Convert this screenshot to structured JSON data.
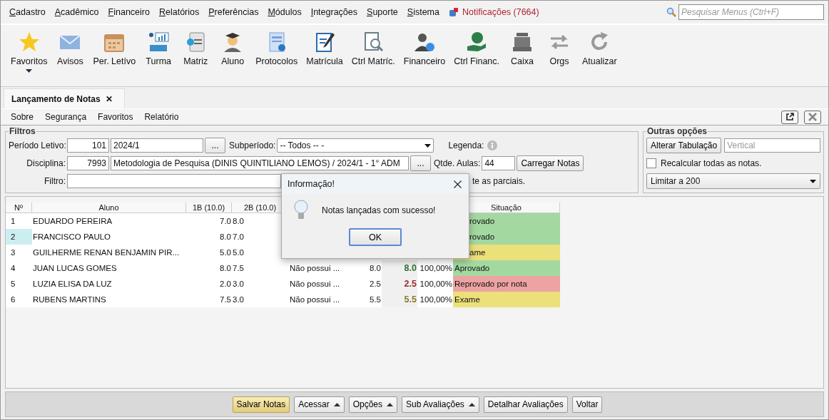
{
  "menu": [
    "Cadastro",
    "Acadêmico",
    "Financeiro",
    "Relatórios",
    "Preferências",
    "Módulos",
    "Integrações",
    "Suporte",
    "Sistema"
  ],
  "notifications": "Notificações (7664)",
  "search": {
    "placeholder": "Pesquisar Menus (Ctrl+F)"
  },
  "toolbar": [
    {
      "label": "Favoritos",
      "dropdown": true
    },
    {
      "label": "Avisos"
    },
    {
      "label": "Per. Letívo"
    },
    {
      "label": "Turma"
    },
    {
      "label": "Matriz"
    },
    {
      "label": "Aluno"
    },
    {
      "label": "Protocolos"
    },
    {
      "label": "Matrícula"
    },
    {
      "label": "Ctrl Matríc."
    },
    {
      "label": "Financeiro"
    },
    {
      "label": "Ctrl Financ."
    },
    {
      "label": "Caixa"
    },
    {
      "label": "Orgs"
    },
    {
      "label": "Atualizar"
    }
  ],
  "tab": {
    "label": "Lançamento de Notas",
    "close": "✕"
  },
  "submenu": [
    "Sobre",
    "Segurança",
    "Favoritos",
    "Relatório"
  ],
  "filters": {
    "title": "Filtros",
    "periodo": {
      "label": "Período Letivo:",
      "code": "101",
      "value": "2024/1",
      "browse": "..."
    },
    "subperiodo": {
      "label": "Subperíodo:",
      "value": "-- Todos -- -"
    },
    "legenda": "Legenda:",
    "disciplina": {
      "label": "Disciplina:",
      "code": "7993",
      "value": "Metodologia de Pesquisa (DINIS QUINTILIANO LEMOS) / 2024/1 - 1° ADM",
      "browse": "..."
    },
    "aulas": {
      "label": "Qtde. Aulas:",
      "value": "44"
    },
    "load_button": "Carregar Notas",
    "filtro": {
      "label": "Filtro:"
    },
    "partial_option": "te as parciais."
  },
  "other_options": {
    "title": "Outras opções",
    "tab_button": "Alterar Tabulação",
    "tab_value": "Vertical",
    "recalc": {
      "label": "Recalcular todas as notas.",
      "checked": false
    },
    "limit": "Limitar a 200"
  },
  "table": {
    "columns": [
      {
        "label": "Nº"
      },
      {
        "label": "Aluno"
      },
      {
        "label": "1B (10.0)"
      },
      {
        "label": "2B (10.0)"
      },
      {},
      {},
      {},
      {},
      {
        "label": "Situação"
      }
    ],
    "rows": [
      {
        "num": "1",
        "name": "EDUARDO PEREIRA",
        "b1": "7.0",
        "b2": "8.0",
        "selected": false,
        "status": {
          "text": "rovado",
          "color": "#a3d9a0"
        }
      },
      {
        "num": "2",
        "name": "FRANCISCO PAULO",
        "b1": "8.0",
        "b2": "7.0",
        "selected": true,
        "status": {
          "text": "rovado",
          "color": "#a3d9a0"
        }
      },
      {
        "num": "3",
        "name": "GUILHERME RENAN BENJAMIN PIR...",
        "b1": "5.0",
        "b2": "5.0",
        "selected": false,
        "status": {
          "text": "ame",
          "color": "#ece07a"
        }
      },
      {
        "num": "4",
        "name": "JUAN LUCAS GOMES",
        "b1": "8.0",
        "b2": "7.5",
        "selected": false,
        "obs": "Não possui ...",
        "media": "8.0",
        "final": {
          "text": "8.0",
          "color": "#2f6f2f"
        },
        "freq": "100,00%",
        "status": {
          "text": "Aprovado",
          "color": "#a3d9a0"
        }
      },
      {
        "num": "5",
        "name": "LUZIA ELISA DA LUZ",
        "b1": "2.0",
        "b2": "3.0",
        "selected": false,
        "obs": "Não possui ...",
        "media": "2.5",
        "final": {
          "text": "2.5",
          "color": "#9c2b2b"
        },
        "freq": "100,00%",
        "status": {
          "text": "Reprovado por nota",
          "color": "#eea3a3"
        }
      },
      {
        "num": "6",
        "name": "RUBENS MARTINS",
        "b1": "7.5",
        "b2": "3.0",
        "selected": false,
        "obs": "Não possui ...",
        "media": "5.5",
        "final": {
          "text": "5.5",
          "color": "#8a7a1f"
        },
        "freq": "100,00%",
        "status": {
          "text": "Exame",
          "color": "#ece07a"
        }
      }
    ]
  },
  "buttons": [
    {
      "label": "Salvar Notas",
      "default": true
    },
    {
      "label": "Acessar",
      "menu": true
    },
    {
      "label": "Opções",
      "menu": true
    },
    {
      "label": "Sub Avaliações",
      "menu": true
    },
    {
      "label": "Detalhar Avaliações"
    },
    {
      "label": "Voltar"
    }
  ],
  "dialog": {
    "title": "Informação!",
    "message": "Notas lançadas com sucesso!",
    "ok": "OK"
  }
}
